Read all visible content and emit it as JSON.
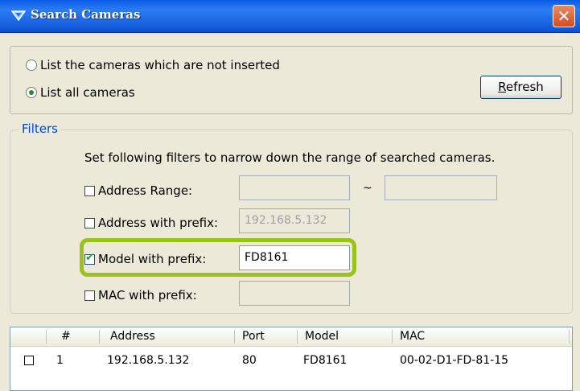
{
  "window": {
    "title": "Search Cameras",
    "close_glyph": "✕"
  },
  "scope": {
    "option_not_inserted": "List the cameras which are not inserted",
    "option_all": "List all cameras",
    "selected": "List all cameras",
    "refresh_prefix": "R",
    "refresh_rest": "efresh"
  },
  "filters": {
    "group_label": "Filters",
    "instruction": "Set following filters to narrow down the range of searched cameras.",
    "address_range": {
      "label": "Address Range:",
      "checked": false,
      "from": "",
      "to": "",
      "separator": "~"
    },
    "address_prefix": {
      "label": "Address with prefix:",
      "checked": false,
      "value": "192.168.5.132"
    },
    "model_prefix": {
      "label": "Model with prefix:",
      "checked": true,
      "value": "FD8161"
    },
    "mac_prefix": {
      "label": "MAC with prefix:",
      "checked": false,
      "value": ""
    }
  },
  "table": {
    "columns": [
      "#",
      "Address",
      "Port",
      "Model",
      "MAC"
    ],
    "rows": [
      {
        "checked": false,
        "num": "1",
        "address": "192.168.5.132",
        "port": "80",
        "model": "FD8161",
        "mac": "00-02-D1-FD-81-15"
      }
    ]
  },
  "colors": {
    "title_bar": "#1a63e0",
    "highlight": "#99c21a",
    "filters_label": "#0046d5"
  }
}
